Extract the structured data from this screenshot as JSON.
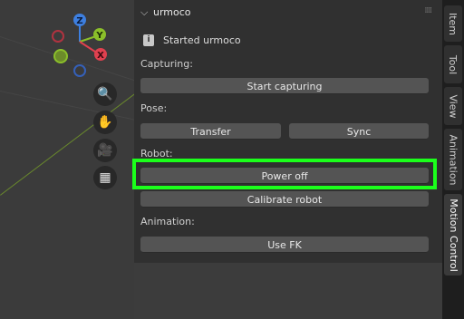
{
  "panel": {
    "title": "urmoco",
    "status_text": "Started urmoco",
    "capturing_label": "Capturing:",
    "start_capturing_label": "Start capturing",
    "pose_label": "Pose:",
    "transfer_label": "Transfer",
    "sync_label": "Sync",
    "robot_label": "Robot:",
    "power_off_label": "Power off",
    "calibrate_label": "Calibrate robot",
    "animation_label": "Animation:",
    "use_fk_label": "Use FK"
  },
  "gizmo": {
    "z": "Z",
    "y": "Y",
    "x": "X"
  },
  "sidebar": {
    "tabs": [
      "Item",
      "Tool",
      "View",
      "Animation",
      "Motion Control"
    ]
  },
  "colors": {
    "highlight": "#1bff1b",
    "x_axis": "#e0404f",
    "y_axis": "#8bbf2a",
    "z_axis": "#3d7fe0"
  }
}
